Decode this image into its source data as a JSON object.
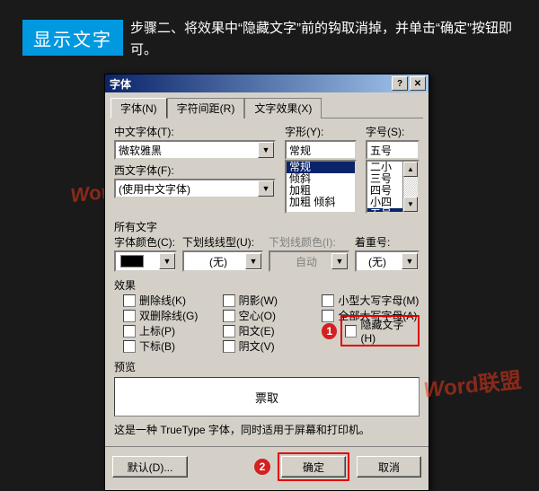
{
  "banner": "显示文字",
  "instruction": "步骤二、将效果中“隐藏文字”前的钩取消掉，并单击“确定”按钮即可。",
  "dialog": {
    "title": "字体",
    "tabs": [
      {
        "label": "字体(N)",
        "active": true
      },
      {
        "label": "字符间距(R)"
      },
      {
        "label": "文字效果(X)"
      }
    ],
    "cn_font": {
      "label": "中文字体(T):",
      "value": "微软雅黑"
    },
    "west_font": {
      "label": "西文字体(F):",
      "value": "(使用中文字体)"
    },
    "style": {
      "label": "字形(Y):",
      "value": "常规",
      "options": [
        "常规",
        "倾斜",
        "加粗",
        "加粗 倾斜"
      ]
    },
    "size": {
      "label": "字号(S):",
      "value": "五号",
      "options": [
        "二小",
        "三号",
        "四号",
        "小四",
        "五号"
      ]
    },
    "allfonts_label": "所有文字",
    "color": {
      "label": "字体颜色(C):"
    },
    "underline": {
      "label": "下划线线型(U):",
      "value": "(无)"
    },
    "ulcolor": {
      "label": "下划线颜色(I):",
      "value": "自动"
    },
    "emphasis": {
      "label": "着重号:",
      "value": "(无)"
    },
    "effects_label": "效果",
    "effects": {
      "c1": [
        {
          "label": "删除线(K)"
        },
        {
          "label": "双删除线(G)"
        },
        {
          "label": "上标(P)"
        },
        {
          "label": "下标(B)"
        }
      ],
      "c2": [
        {
          "label": "阴影(W)"
        },
        {
          "label": "空心(O)"
        },
        {
          "label": "阳文(E)"
        },
        {
          "label": "阴文(V)"
        }
      ],
      "c3": [
        {
          "label": "小型大写字母(M)"
        },
        {
          "label": "全部大写字母(A)"
        },
        {
          "label": "隐藏文字(H)",
          "highlight": true
        }
      ]
    },
    "marker1": "1",
    "preview_label": "预览",
    "preview_text": "票取",
    "note": "这是一种 TrueType 字体，同时适用于屏幕和打印机。",
    "footer": {
      "default": "默认(D)...",
      "ok": "确定",
      "cancel": "取消",
      "marker2": "2"
    }
  },
  "watermark": "Word联盟"
}
